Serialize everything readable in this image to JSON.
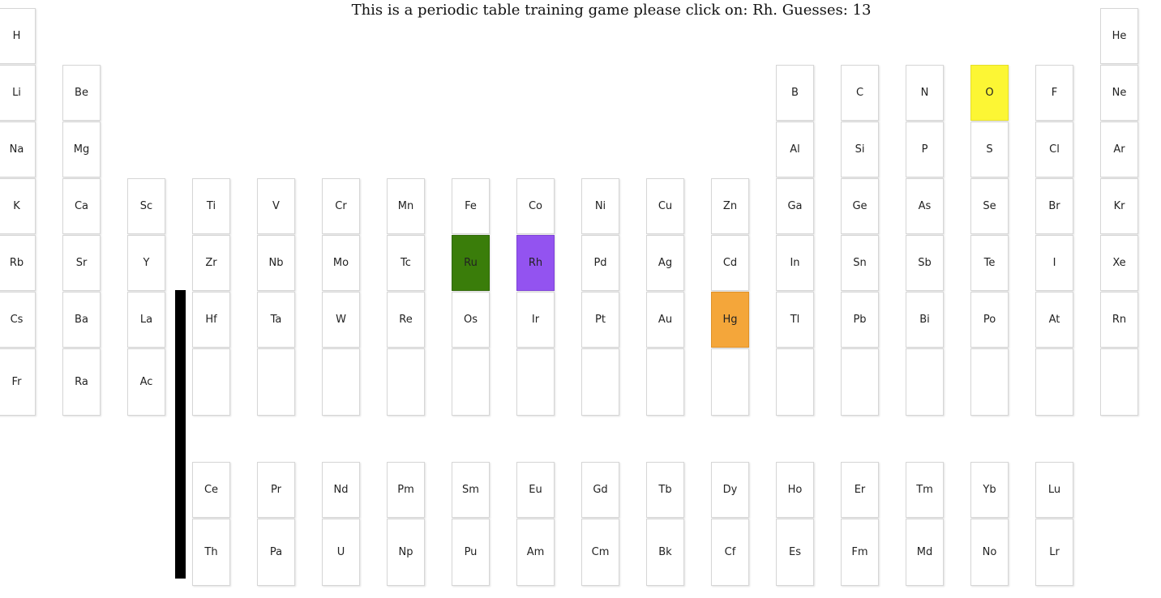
{
  "prompt": {
    "text": "This is a periodic table training game please click on: Rh. Guesses: 13"
  },
  "colors": {
    "yellow": "#fcf634",
    "green": "#3a7d0a",
    "purple": "#9353f0",
    "orange": "#f4a63a"
  },
  "elements": [
    {
      "symbol": "H",
      "row": 0,
      "col": 0
    },
    {
      "symbol": "He",
      "row": 0,
      "col": 17
    },
    {
      "symbol": "Li",
      "row": 1,
      "col": 0
    },
    {
      "symbol": "Be",
      "row": 1,
      "col": 1
    },
    {
      "symbol": "B",
      "row": 1,
      "col": 12
    },
    {
      "symbol": "C",
      "row": 1,
      "col": 13
    },
    {
      "symbol": "N",
      "row": 1,
      "col": 14
    },
    {
      "symbol": "O",
      "row": 1,
      "col": 15,
      "color": "yellow"
    },
    {
      "symbol": "F",
      "row": 1,
      "col": 16
    },
    {
      "symbol": "Ne",
      "row": 1,
      "col": 17
    },
    {
      "symbol": "Na",
      "row": 2,
      "col": 0
    },
    {
      "symbol": "Mg",
      "row": 2,
      "col": 1
    },
    {
      "symbol": "Al",
      "row": 2,
      "col": 12
    },
    {
      "symbol": "Si",
      "row": 2,
      "col": 13
    },
    {
      "symbol": "P",
      "row": 2,
      "col": 14
    },
    {
      "symbol": "S",
      "row": 2,
      "col": 15
    },
    {
      "symbol": "Cl",
      "row": 2,
      "col": 16
    },
    {
      "symbol": "Ar",
      "row": 2,
      "col": 17
    },
    {
      "symbol": "K",
      "row": 3,
      "col": 0
    },
    {
      "symbol": "Ca",
      "row": 3,
      "col": 1
    },
    {
      "symbol": "Sc",
      "row": 3,
      "col": 2
    },
    {
      "symbol": "Ti",
      "row": 3,
      "col": 3
    },
    {
      "symbol": "V",
      "row": 3,
      "col": 4
    },
    {
      "symbol": "Cr",
      "row": 3,
      "col": 5
    },
    {
      "symbol": "Mn",
      "row": 3,
      "col": 6
    },
    {
      "symbol": "Fe",
      "row": 3,
      "col": 7
    },
    {
      "symbol": "Co",
      "row": 3,
      "col": 8
    },
    {
      "symbol": "Ni",
      "row": 3,
      "col": 9
    },
    {
      "symbol": "Cu",
      "row": 3,
      "col": 10
    },
    {
      "symbol": "Zn",
      "row": 3,
      "col": 11
    },
    {
      "symbol": "Ga",
      "row": 3,
      "col": 12
    },
    {
      "symbol": "Ge",
      "row": 3,
      "col": 13
    },
    {
      "symbol": "As",
      "row": 3,
      "col": 14
    },
    {
      "symbol": "Se",
      "row": 3,
      "col": 15
    },
    {
      "symbol": "Br",
      "row": 3,
      "col": 16
    },
    {
      "symbol": "Kr",
      "row": 3,
      "col": 17
    },
    {
      "symbol": "Rb",
      "row": 4,
      "col": 0
    },
    {
      "symbol": "Sr",
      "row": 4,
      "col": 1
    },
    {
      "symbol": "Y",
      "row": 4,
      "col": 2
    },
    {
      "symbol": "Zr",
      "row": 4,
      "col": 3
    },
    {
      "symbol": "Nb",
      "row": 4,
      "col": 4
    },
    {
      "symbol": "Mo",
      "row": 4,
      "col": 5
    },
    {
      "symbol": "Tc",
      "row": 4,
      "col": 6
    },
    {
      "symbol": "Ru",
      "row": 4,
      "col": 7,
      "color": "green"
    },
    {
      "symbol": "Rh",
      "row": 4,
      "col": 8,
      "color": "purple"
    },
    {
      "symbol": "Pd",
      "row": 4,
      "col": 9
    },
    {
      "symbol": "Ag",
      "row": 4,
      "col": 10
    },
    {
      "symbol": "Cd",
      "row": 4,
      "col": 11
    },
    {
      "symbol": "In",
      "row": 4,
      "col": 12
    },
    {
      "symbol": "Sn",
      "row": 4,
      "col": 13
    },
    {
      "symbol": "Sb",
      "row": 4,
      "col": 14
    },
    {
      "symbol": "Te",
      "row": 4,
      "col": 15
    },
    {
      "symbol": "I",
      "row": 4,
      "col": 16
    },
    {
      "symbol": "Xe",
      "row": 4,
      "col": 17
    },
    {
      "symbol": "Cs",
      "row": 5,
      "col": 0
    },
    {
      "symbol": "Ba",
      "row": 5,
      "col": 1
    },
    {
      "symbol": "La",
      "row": 5,
      "col": 2
    },
    {
      "symbol": "Hf",
      "row": 5,
      "col": 3
    },
    {
      "symbol": "Ta",
      "row": 5,
      "col": 4
    },
    {
      "symbol": "W",
      "row": 5,
      "col": 5
    },
    {
      "symbol": "Re",
      "row": 5,
      "col": 6
    },
    {
      "symbol": "Os",
      "row": 5,
      "col": 7
    },
    {
      "symbol": "Ir",
      "row": 5,
      "col": 8
    },
    {
      "symbol": "Pt",
      "row": 5,
      "col": 9
    },
    {
      "symbol": "Au",
      "row": 5,
      "col": 10
    },
    {
      "symbol": "Hg",
      "row": 5,
      "col": 11,
      "color": "orange"
    },
    {
      "symbol": "Tl",
      "row": 5,
      "col": 12
    },
    {
      "symbol": "Pb",
      "row": 5,
      "col": 13
    },
    {
      "symbol": "Bi",
      "row": 5,
      "col": 14
    },
    {
      "symbol": "Po",
      "row": 5,
      "col": 15
    },
    {
      "symbol": "At",
      "row": 5,
      "col": 16
    },
    {
      "symbol": "Rn",
      "row": 5,
      "col": 17
    },
    {
      "symbol": "Fr",
      "row": 6,
      "col": 0
    },
    {
      "symbol": "Ra",
      "row": 6,
      "col": 1
    },
    {
      "symbol": "Ac",
      "row": 6,
      "col": 2
    },
    {
      "symbol": "",
      "row": 6,
      "col": 3
    },
    {
      "symbol": "",
      "row": 6,
      "col": 4
    },
    {
      "symbol": "",
      "row": 6,
      "col": 5
    },
    {
      "symbol": "",
      "row": 6,
      "col": 6
    },
    {
      "symbol": "",
      "row": 6,
      "col": 7
    },
    {
      "symbol": "",
      "row": 6,
      "col": 8
    },
    {
      "symbol": "",
      "row": 6,
      "col": 9
    },
    {
      "symbol": "",
      "row": 6,
      "col": 10
    },
    {
      "symbol": "",
      "row": 6,
      "col": 11
    },
    {
      "symbol": "",
      "row": 6,
      "col": 12
    },
    {
      "symbol": "",
      "row": 6,
      "col": 13
    },
    {
      "symbol": "",
      "row": 6,
      "col": 14
    },
    {
      "symbol": "",
      "row": 6,
      "col": 15
    },
    {
      "symbol": "",
      "row": 6,
      "col": 16
    },
    {
      "symbol": "",
      "row": 6,
      "col": 17
    },
    {
      "symbol": "Ce",
      "row": 8,
      "col": 3
    },
    {
      "symbol": "Pr",
      "row": 8,
      "col": 4
    },
    {
      "symbol": "Nd",
      "row": 8,
      "col": 5
    },
    {
      "symbol": "Pm",
      "row": 8,
      "col": 6
    },
    {
      "symbol": "Sm",
      "row": 8,
      "col": 7
    },
    {
      "symbol": "Eu",
      "row": 8,
      "col": 8
    },
    {
      "symbol": "Gd",
      "row": 8,
      "col": 9
    },
    {
      "symbol": "Tb",
      "row": 8,
      "col": 10
    },
    {
      "symbol": "Dy",
      "row": 8,
      "col": 11
    },
    {
      "symbol": "Ho",
      "row": 8,
      "col": 12
    },
    {
      "symbol": "Er",
      "row": 8,
      "col": 13
    },
    {
      "symbol": "Tm",
      "row": 8,
      "col": 14
    },
    {
      "symbol": "Yb",
      "row": 8,
      "col": 15
    },
    {
      "symbol": "Lu",
      "row": 8,
      "col": 16
    },
    {
      "symbol": "Th",
      "row": 9,
      "col": 3
    },
    {
      "symbol": "Pa",
      "row": 9,
      "col": 4
    },
    {
      "symbol": "U",
      "row": 9,
      "col": 5
    },
    {
      "symbol": "Np",
      "row": 9,
      "col": 6
    },
    {
      "symbol": "Pu",
      "row": 9,
      "col": 7
    },
    {
      "symbol": "Am",
      "row": 9,
      "col": 8
    },
    {
      "symbol": "Cm",
      "row": 9,
      "col": 9
    },
    {
      "symbol": "Bk",
      "row": 9,
      "col": 10
    },
    {
      "symbol": "Cf",
      "row": 9,
      "col": 11
    },
    {
      "symbol": "Es",
      "row": 9,
      "col": 12
    },
    {
      "symbol": "Fm",
      "row": 9,
      "col": 13
    },
    {
      "symbol": "Md",
      "row": 9,
      "col": 14
    },
    {
      "symbol": "No",
      "row": 9,
      "col": 15
    },
    {
      "symbol": "Lr",
      "row": 9,
      "col": 16
    }
  ]
}
